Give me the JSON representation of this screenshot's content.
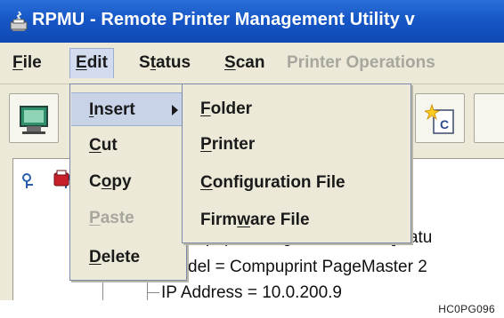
{
  "window": {
    "title": "RPMU - Remote Printer Management Utility v"
  },
  "menubar": {
    "items": [
      {
        "label": "File",
        "mnemonic": "F",
        "rest": "ile"
      },
      {
        "label": "Edit",
        "mnemonic": "E",
        "rest": "dit"
      },
      {
        "label": "Status",
        "pre": "S",
        "mnemonic": "t",
        "rest": "atus"
      },
      {
        "label": "Scan",
        "mnemonic": "S",
        "rest": "can"
      },
      {
        "label": "Printer Operations"
      }
    ]
  },
  "edit_menu": {
    "items": [
      {
        "label": "Insert",
        "mnemonic": "I",
        "rest": "nsert"
      },
      {
        "label": "Cut",
        "mnemonic": "C",
        "rest": "ut"
      },
      {
        "label": "Copy",
        "pre": "C",
        "mnemonic": "o",
        "rest": "py"
      },
      {
        "label": "Paste",
        "mnemonic": "P",
        "rest": "aste"
      },
      {
        "label": "Delete",
        "mnemonic": "D",
        "rest": "elete"
      }
    ]
  },
  "insert_submenu": {
    "items": [
      {
        "label": "Folder",
        "mnemonic": "F",
        "rest": "older"
      },
      {
        "label": "Printer",
        "mnemonic": "P",
        "rest": "rinter"
      },
      {
        "label": "Configuration File",
        "mnemonic": "C",
        "rest": "onfiguration File"
      },
      {
        "label": "Firmware File",
        "pre": "Firm",
        "mnemonic": "w",
        "rest": "are File"
      }
    ]
  },
  "tree": {
    "row1": "mpuprint PageMaster 280 [statu",
    "row2": "del = Compuprint PageMaster 2",
    "row3": "IP Address = 10.0.200.9"
  },
  "image_code": "HC0PG096",
  "colors": {
    "titlebar": "#1657c6",
    "menu_highlight": "#c8d3e8",
    "disabled_text": "#a8a79e"
  },
  "icons": [
    "app-icon",
    "printer-screen-icon",
    "config-star-icon",
    "tree-key-icon",
    "tree-printer-icon"
  ]
}
